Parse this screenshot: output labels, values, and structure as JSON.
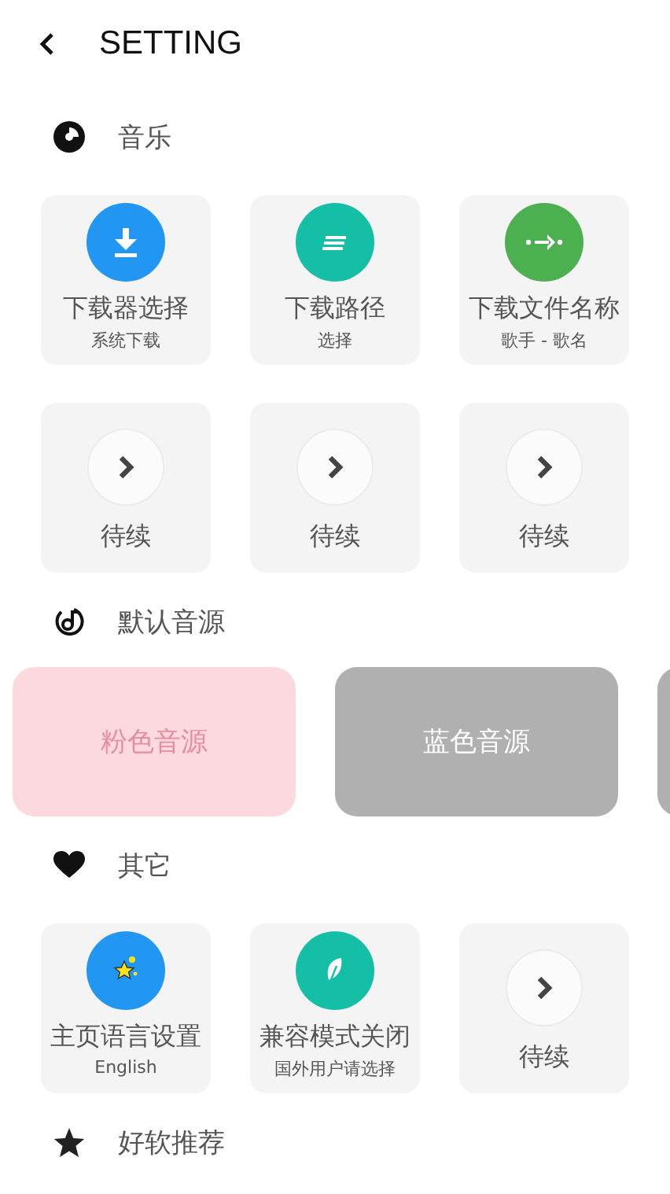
{
  "header": {
    "title": "SETTING"
  },
  "sections": [
    {
      "title": "音乐",
      "kind": "tiles",
      "tiles": [
        {
          "kind": "action",
          "color": "#2196f3",
          "title": "下载器选择",
          "subtitle": "系统下载"
        },
        {
          "kind": "action",
          "color": "#14bfa6",
          "title": "下载路径",
          "subtitle": "选择"
        },
        {
          "kind": "action",
          "color": "#4caf50",
          "title": "下载文件名称",
          "subtitle": "歌手 - 歌名"
        },
        {
          "kind": "pending",
          "title": "待续"
        },
        {
          "kind": "pending",
          "title": "待续"
        },
        {
          "kind": "pending",
          "title": "待续"
        }
      ]
    },
    {
      "title": "默认音源",
      "kind": "sources",
      "sources": [
        {
          "label": "粉色音源",
          "color": "#fcd9de"
        },
        {
          "label": "蓝色音源",
          "color": "#b0b0b0"
        },
        {
          "color": "#b0b0b0"
        }
      ]
    },
    {
      "title": "其它",
      "kind": "tiles",
      "tiles": [
        {
          "kind": "action",
          "color": "#2196f3",
          "title": "主页语言设置",
          "subtitle": "English"
        },
        {
          "kind": "action",
          "color": "#14bfa6",
          "title": "兼容模式关闭",
          "subtitle": "国外用户请选择"
        },
        {
          "kind": "pending",
          "title": "待续"
        }
      ]
    },
    {
      "title": "好软推荐",
      "kind": "empty"
    }
  ]
}
